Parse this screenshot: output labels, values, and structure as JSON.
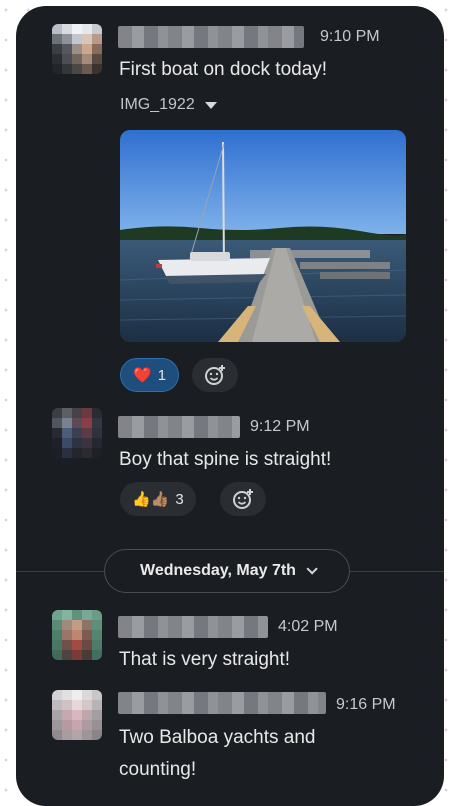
{
  "messages": [
    {
      "time": "9:10 PM",
      "text": "First boat on dock today!",
      "attachment": {
        "filename": "IMG_1922",
        "toggle_icon": "caret-down-icon"
      },
      "reactions": [
        {
          "emoji": "❤️",
          "count": "1",
          "active": true
        }
      ],
      "add_reaction_icon": "add-emoji-icon"
    },
    {
      "time": "9:12 PM",
      "text": "Boy that spine is straight!",
      "reactions": [
        {
          "emoji": "👍👍🏽",
          "count": "3",
          "active": false
        }
      ],
      "add_reaction_icon": "add-emoji-icon"
    }
  ],
  "date_divider": {
    "label": "Wednesday, May 7th",
    "icon": "chevron-down-icon"
  },
  "later_messages": [
    {
      "time": "4:02 PM",
      "text": "That is very straight!"
    },
    {
      "time": "9:16 PM",
      "text_line1": "Two Balboa yachts and",
      "text_line2": "counting!"
    }
  ],
  "colors": {
    "background": "#1a1d21",
    "reaction_active": "#1d4e7e",
    "text": "#e8e8e8"
  }
}
